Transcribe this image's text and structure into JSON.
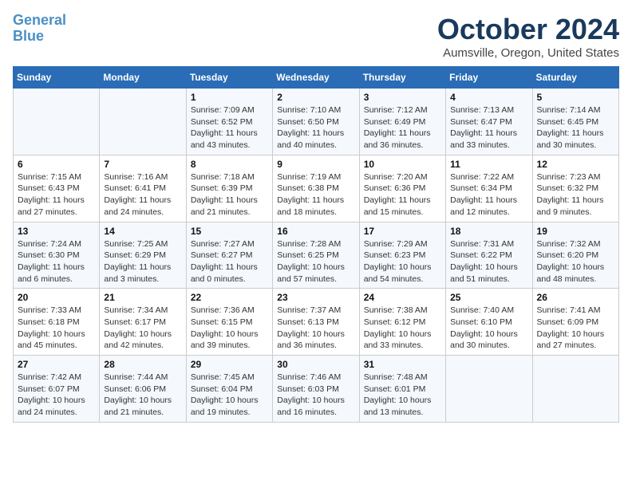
{
  "logo": {
    "line1": "General",
    "line2": "Blue"
  },
  "header": {
    "title": "October 2024",
    "subtitle": "Aumsville, Oregon, United States"
  },
  "weekdays": [
    "Sunday",
    "Monday",
    "Tuesday",
    "Wednesday",
    "Thursday",
    "Friday",
    "Saturday"
  ],
  "weeks": [
    [
      {
        "day": "",
        "info": ""
      },
      {
        "day": "",
        "info": ""
      },
      {
        "day": "1",
        "info": "Sunrise: 7:09 AM\nSunset: 6:52 PM\nDaylight: 11 hours and 43 minutes."
      },
      {
        "day": "2",
        "info": "Sunrise: 7:10 AM\nSunset: 6:50 PM\nDaylight: 11 hours and 40 minutes."
      },
      {
        "day": "3",
        "info": "Sunrise: 7:12 AM\nSunset: 6:49 PM\nDaylight: 11 hours and 36 minutes."
      },
      {
        "day": "4",
        "info": "Sunrise: 7:13 AM\nSunset: 6:47 PM\nDaylight: 11 hours and 33 minutes."
      },
      {
        "day": "5",
        "info": "Sunrise: 7:14 AM\nSunset: 6:45 PM\nDaylight: 11 hours and 30 minutes."
      }
    ],
    [
      {
        "day": "6",
        "info": "Sunrise: 7:15 AM\nSunset: 6:43 PM\nDaylight: 11 hours and 27 minutes."
      },
      {
        "day": "7",
        "info": "Sunrise: 7:16 AM\nSunset: 6:41 PM\nDaylight: 11 hours and 24 minutes."
      },
      {
        "day": "8",
        "info": "Sunrise: 7:18 AM\nSunset: 6:39 PM\nDaylight: 11 hours and 21 minutes."
      },
      {
        "day": "9",
        "info": "Sunrise: 7:19 AM\nSunset: 6:38 PM\nDaylight: 11 hours and 18 minutes."
      },
      {
        "day": "10",
        "info": "Sunrise: 7:20 AM\nSunset: 6:36 PM\nDaylight: 11 hours and 15 minutes."
      },
      {
        "day": "11",
        "info": "Sunrise: 7:22 AM\nSunset: 6:34 PM\nDaylight: 11 hours and 12 minutes."
      },
      {
        "day": "12",
        "info": "Sunrise: 7:23 AM\nSunset: 6:32 PM\nDaylight: 11 hours and 9 minutes."
      }
    ],
    [
      {
        "day": "13",
        "info": "Sunrise: 7:24 AM\nSunset: 6:30 PM\nDaylight: 11 hours and 6 minutes."
      },
      {
        "day": "14",
        "info": "Sunrise: 7:25 AM\nSunset: 6:29 PM\nDaylight: 11 hours and 3 minutes."
      },
      {
        "day": "15",
        "info": "Sunrise: 7:27 AM\nSunset: 6:27 PM\nDaylight: 11 hours and 0 minutes."
      },
      {
        "day": "16",
        "info": "Sunrise: 7:28 AM\nSunset: 6:25 PM\nDaylight: 10 hours and 57 minutes."
      },
      {
        "day": "17",
        "info": "Sunrise: 7:29 AM\nSunset: 6:23 PM\nDaylight: 10 hours and 54 minutes."
      },
      {
        "day": "18",
        "info": "Sunrise: 7:31 AM\nSunset: 6:22 PM\nDaylight: 10 hours and 51 minutes."
      },
      {
        "day": "19",
        "info": "Sunrise: 7:32 AM\nSunset: 6:20 PM\nDaylight: 10 hours and 48 minutes."
      }
    ],
    [
      {
        "day": "20",
        "info": "Sunrise: 7:33 AM\nSunset: 6:18 PM\nDaylight: 10 hours and 45 minutes."
      },
      {
        "day": "21",
        "info": "Sunrise: 7:34 AM\nSunset: 6:17 PM\nDaylight: 10 hours and 42 minutes."
      },
      {
        "day": "22",
        "info": "Sunrise: 7:36 AM\nSunset: 6:15 PM\nDaylight: 10 hours and 39 minutes."
      },
      {
        "day": "23",
        "info": "Sunrise: 7:37 AM\nSunset: 6:13 PM\nDaylight: 10 hours and 36 minutes."
      },
      {
        "day": "24",
        "info": "Sunrise: 7:38 AM\nSunset: 6:12 PM\nDaylight: 10 hours and 33 minutes."
      },
      {
        "day": "25",
        "info": "Sunrise: 7:40 AM\nSunset: 6:10 PM\nDaylight: 10 hours and 30 minutes."
      },
      {
        "day": "26",
        "info": "Sunrise: 7:41 AM\nSunset: 6:09 PM\nDaylight: 10 hours and 27 minutes."
      }
    ],
    [
      {
        "day": "27",
        "info": "Sunrise: 7:42 AM\nSunset: 6:07 PM\nDaylight: 10 hours and 24 minutes."
      },
      {
        "day": "28",
        "info": "Sunrise: 7:44 AM\nSunset: 6:06 PM\nDaylight: 10 hours and 21 minutes."
      },
      {
        "day": "29",
        "info": "Sunrise: 7:45 AM\nSunset: 6:04 PM\nDaylight: 10 hours and 19 minutes."
      },
      {
        "day": "30",
        "info": "Sunrise: 7:46 AM\nSunset: 6:03 PM\nDaylight: 10 hours and 16 minutes."
      },
      {
        "day": "31",
        "info": "Sunrise: 7:48 AM\nSunset: 6:01 PM\nDaylight: 10 hours and 13 minutes."
      },
      {
        "day": "",
        "info": ""
      },
      {
        "day": "",
        "info": ""
      }
    ]
  ]
}
